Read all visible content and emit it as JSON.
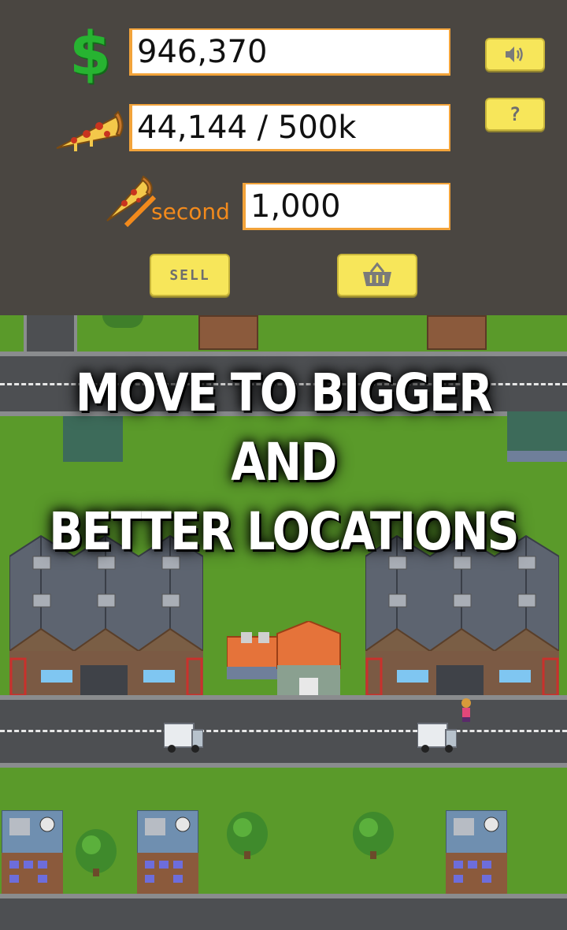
{
  "hud": {
    "money": "946,370",
    "pizzas": "44,144 / 500k",
    "rate_unit": "second",
    "rate": "1,000",
    "sell_label": "SELL",
    "help_label": "?",
    "icons": {
      "money": "dollar-icon",
      "pizzas": "pizza-slice-icon",
      "rate": "pizza-per-second-icon",
      "sound": "speaker-icon",
      "shop": "basket-icon"
    }
  },
  "banner": {
    "line1": "MOVE TO BIGGER AND",
    "line2": "BETTER LOCATIONS"
  },
  "colors": {
    "accent_orange": "#f2a33a",
    "button_yellow": "#f7e65a",
    "money_green": "#27b331",
    "grass": "#5a9a2a"
  }
}
